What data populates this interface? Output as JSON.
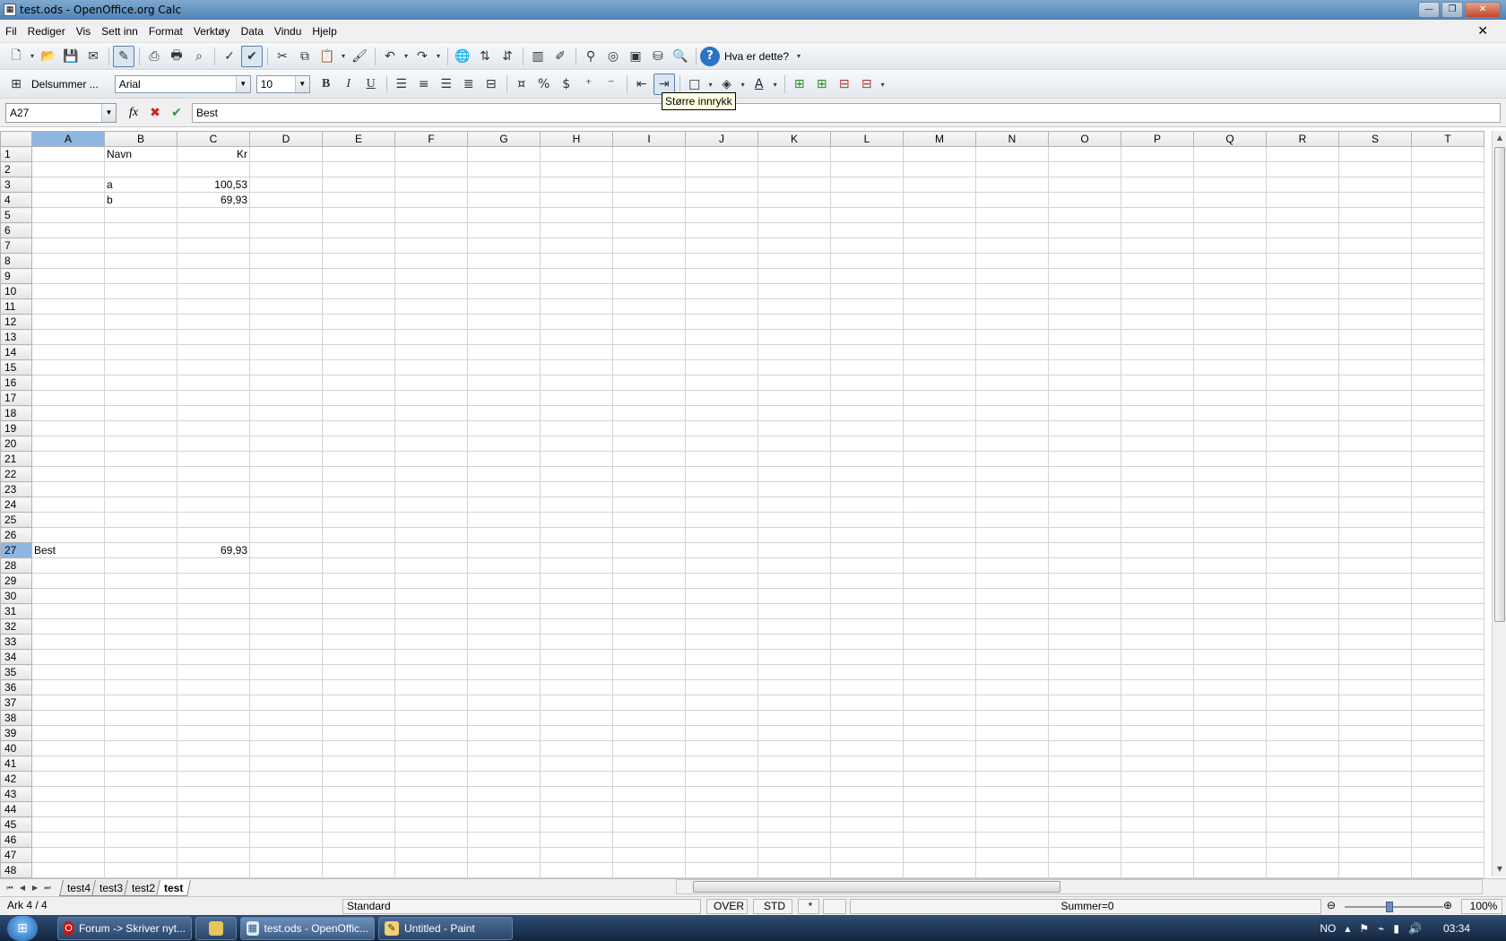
{
  "window": {
    "title": "test.ods - OpenOffice.org Calc",
    "minimize": "—",
    "maximize": "❐",
    "close": "✕"
  },
  "menu": [
    "Fil",
    "Rediger",
    "Vis",
    "Sett inn",
    "Format",
    "Verktøy",
    "Data",
    "Vindu",
    "Hjelp"
  ],
  "menu_close": "✕",
  "toolbar1": {
    "help_label": "Hva er dette?",
    "icons": [
      "new-icon",
      "open-icon",
      "save-icon",
      "email-icon",
      "edit-mode-icon",
      "export-pdf-icon",
      "print-icon",
      "print-preview-icon",
      "spellcheck-icon",
      "autospellcheck-icon",
      "cut-icon",
      "copy-icon",
      "paste-icon",
      "clone-format-icon",
      "undo-icon",
      "redo-icon",
      "hyperlink-icon",
      "sort-ascending-icon",
      "sort-descending-icon",
      "chart-icon",
      "show-draw-icon",
      "find-replace-icon",
      "navigator-icon",
      "gallery-icon",
      "data-sources-icon",
      "zoom-icon",
      "help-icon"
    ]
  },
  "toolbar2": {
    "style_label": "Delsummer ...",
    "font_name": "Arial",
    "font_size": "10",
    "bold": "B",
    "italic": "I",
    "underline": "U",
    "font_color_glyph": "A"
  },
  "tooltip": "Større innrykk",
  "formula_bar": {
    "name_box": "A27",
    "content": "Best"
  },
  "columns": [
    "A",
    "B",
    "C",
    "D",
    "E",
    "F",
    "G",
    "H",
    "I",
    "J",
    "K",
    "L",
    "M",
    "N",
    "O",
    "P",
    "Q",
    "R",
    "S",
    "T"
  ],
  "selected_row": 27,
  "selected_col": "A",
  "cells": {
    "1": {
      "B": "Navn",
      "C": "Kr"
    },
    "3": {
      "B": "a",
      "C": "100,53"
    },
    "4": {
      "B": "b",
      "C": "69,93"
    },
    "27": {
      "A": "Best",
      "C": "69,93"
    }
  },
  "numeric_cols": [
    "C"
  ],
  "row_count": 48,
  "sheet_tabs": [
    "test4",
    "test3",
    "test2",
    "test"
  ],
  "active_sheet": "test",
  "status": {
    "sheet": "Ark 4 / 4",
    "page_style": "Standard",
    "insert_mode": "OVER",
    "selection_mode": "STD",
    "modified": "*",
    "sum": "Summer=0",
    "zoom_minus": "⊖",
    "zoom_plus": "⊕",
    "zoom": "100%"
  },
  "taskbar": {
    "tasks": [
      "Forum -> Skriver nyt...",
      "",
      "test.ods - OpenOffic...",
      "Untitled - Paint"
    ],
    "lang": "NO",
    "clock": "03:34"
  }
}
